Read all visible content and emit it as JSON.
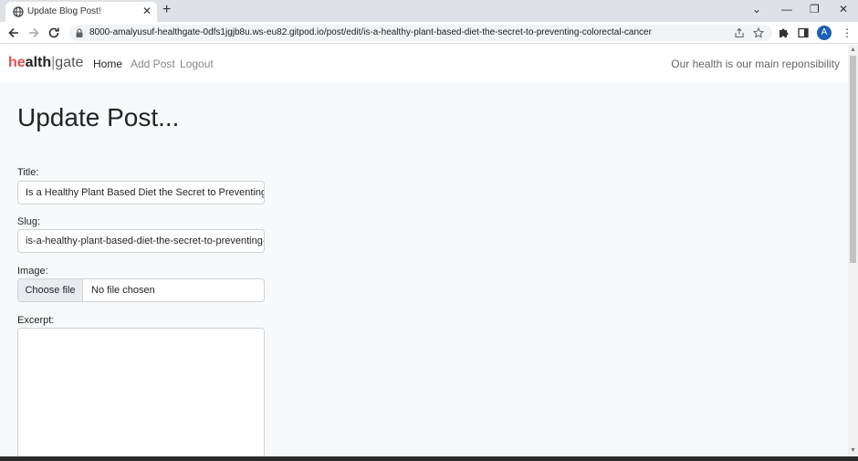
{
  "browser": {
    "tab_title": "Update Blog Post!",
    "tab_close": "✕",
    "new_tab": "+",
    "url": "8000-amalyusuf-healthgate-0dfs1jgjb8u.ws-eu82.gitpod.io/post/edit/is-a-healthy-plant-based-diet-the-secret-to-preventing-colorectal-cancer",
    "avatar_letter": "A",
    "window_controls": [
      "⌄",
      "—",
      "❐",
      "✕"
    ],
    "menu": "⋮"
  },
  "navbar": {
    "brand_he": "he",
    "brand_alth": "alth",
    "brand_sep": "|",
    "brand_gate": "gate",
    "links": [
      "Home",
      "Add Post",
      "Logout"
    ],
    "tagline": "Our health is our main reponsibility"
  },
  "form": {
    "heading": "Update Post...",
    "title_label": "Title:",
    "title_value": "Is a Healthy Plant Based Diet the Secret to Preventing Colorectal Cancer",
    "slug_label": "Slug:",
    "slug_value": "is-a-healthy-plant-based-diet-the-secret-to-preventing-colorectal-cancer",
    "image_label": "Image:",
    "file_button": "Choose file",
    "file_status": "No file chosen",
    "excerpt_label": "Excerpt:"
  },
  "scrollbar": {
    "up": "▲",
    "down": "▼"
  },
  "colors": {
    "brand_accent": "#d9534f",
    "avatar": "#1a5fb4",
    "page_bg": "#f8f9fa"
  }
}
